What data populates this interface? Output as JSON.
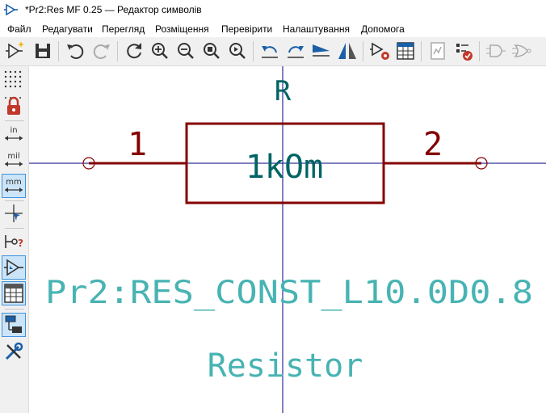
{
  "window": {
    "title": "*Pr2:Res MF 0.25 — Редактор символів"
  },
  "menu": {
    "file": "Файл",
    "edit": "Редагувати",
    "view": "Перегляд",
    "place": "Розміщення",
    "inspect": "Перевірити",
    "preferences": "Налаштування",
    "help": "Допомога"
  },
  "left_toolbar": {
    "units_in": "in",
    "units_mil": "mil",
    "units_mm": "mm"
  },
  "symbol": {
    "reference": "R",
    "value": "1kOm",
    "footprint": "Pr2:RES_CONST_L10.0D0.8",
    "description": "Resistor",
    "pins": [
      {
        "number": "1"
      },
      {
        "number": "2"
      }
    ]
  },
  "colors": {
    "body": "#840000",
    "reference_value": "#006464",
    "fields": "#48b3b3",
    "axis": "#000084",
    "accent": "#3d94e0"
  }
}
